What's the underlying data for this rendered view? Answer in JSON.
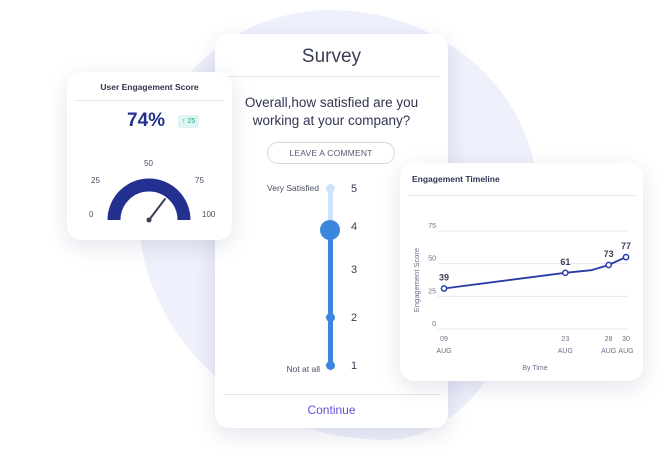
{
  "survey": {
    "title": "Survey",
    "question": "Overall,how satisfied are you working at your company?",
    "comment_button": "LEAVE A COMMENT",
    "scale": [
      {
        "value": "5",
        "label": "Very Satisfied"
      },
      {
        "value": "4",
        "label": ""
      },
      {
        "value": "3",
        "label": ""
      },
      {
        "value": "2",
        "label": ""
      },
      {
        "value": "1",
        "label": "Not at all"
      }
    ],
    "selected_value": 4,
    "continue_label": "Continue"
  },
  "engagement_score": {
    "title": "User Engagement Score",
    "value": "74%",
    "change": "25",
    "gauge_labels": [
      "0",
      "25",
      "50",
      "75",
      "100"
    ],
    "gauge_level": 74
  },
  "timeline": {
    "title": "Engagement Timeline",
    "chart_data": {
      "type": "line",
      "x": [
        "09 AUG",
        "23 AUG",
        "28 AUG",
        "30 AUG"
      ],
      "x_tick_days": [
        "09",
        "23",
        "28",
        "30"
      ],
      "x_tick_month": "AUG",
      "points": [
        {
          "x": "2024-08-09",
          "y": 31,
          "label": "39"
        },
        {
          "x": "2024-08-23",
          "y": 43,
          "label": "61"
        },
        {
          "x": "2024-08-26",
          "y": 45,
          "label": ""
        },
        {
          "x": "2024-08-28",
          "y": 49,
          "label": "73"
        },
        {
          "x": "2024-08-30",
          "y": 55,
          "label": "77"
        }
      ],
      "yticks": [
        "0",
        "25",
        "50",
        "75"
      ],
      "ylim": [
        0,
        75
      ],
      "xlabel": "By Time",
      "ylabel": "Engagement Score",
      "color": "#2a3aa6"
    }
  },
  "colors": {
    "accent": "#3b86dc",
    "gauge": "#23308f",
    "badge": "#1fa893",
    "continue": "#6a4fcf"
  }
}
